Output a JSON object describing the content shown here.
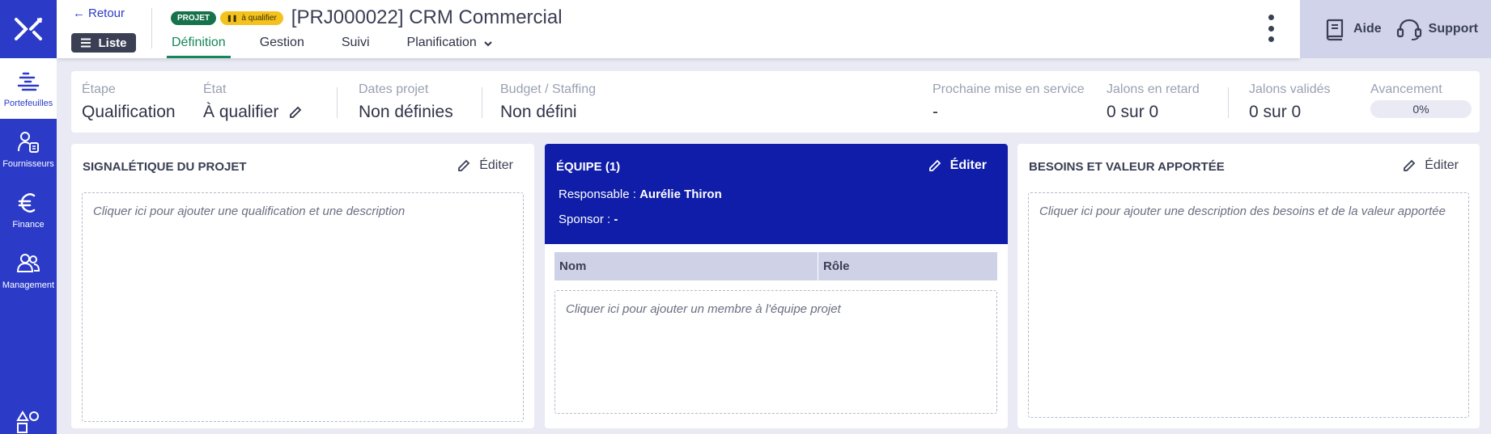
{
  "sidebar": {
    "items": [
      {
        "label": "Portefeuilles",
        "icon": "portfolio-icon",
        "active": true
      },
      {
        "label": "Fournisseurs",
        "icon": "suppliers-icon",
        "active": false
      },
      {
        "label": "Finance",
        "icon": "euro-icon",
        "active": false
      },
      {
        "label": "Management",
        "icon": "people-icon",
        "active": false
      }
    ]
  },
  "header": {
    "back_label": "Retour",
    "list_label": "Liste",
    "badge_type": "PROJET",
    "badge_state": "à qualifier",
    "title": "[PRJ000022] CRM Commercial",
    "tabs": [
      {
        "label": "Définition",
        "active": true
      },
      {
        "label": "Gestion",
        "active": false
      },
      {
        "label": "Suivi",
        "active": false
      },
      {
        "label": "Planification",
        "active": false
      }
    ],
    "help_label": "Aide",
    "support_label": "Support"
  },
  "summary": {
    "etape_label": "Étape",
    "etape_value": "Qualification",
    "etat_label": "État",
    "etat_value": "À qualifier",
    "dates_label": "Dates projet",
    "dates_value": "Non définies",
    "budget_label": "Budget / Staffing",
    "budget_value": "Non défini",
    "mise_label": "Prochaine mise en service",
    "mise_value": "-",
    "retard_label": "Jalons en retard",
    "retard_value": "0 sur 0",
    "valides_label": "Jalons validés",
    "valides_value": "0 sur 0",
    "avancement_label": "Avancement",
    "avancement_value": "0%",
    "avancement_fraction": 0
  },
  "signaletique": {
    "title": "SIGNALÉTIQUE DU PROJET",
    "edit_label": "Éditer",
    "placeholder": "Cliquer ici pour ajouter une qualification et une description"
  },
  "equipe": {
    "title": "ÉQUIPE (1)",
    "edit_label": "Éditer",
    "responsable_label": "Responsable :",
    "responsable_value": "Aurélie Thiron",
    "sponsor_label": "Sponsor :",
    "sponsor_value": "-",
    "col_nom": "Nom",
    "col_role": "Rôle",
    "placeholder": "Cliquer ici pour ajouter un membre à l'équipe projet"
  },
  "besoins": {
    "title": "BESOINS ET VALEUR APPORTÉE",
    "edit_label": "Éditer",
    "placeholder": "Cliquer ici pour ajouter une description des besoins et de la valeur apportée"
  },
  "colors": {
    "sidebar": "#2b3bc8",
    "team_header": "#0f1da8",
    "active_tab": "#17865a",
    "badge_projet": "#17724b",
    "badge_state": "#f4c21f"
  }
}
